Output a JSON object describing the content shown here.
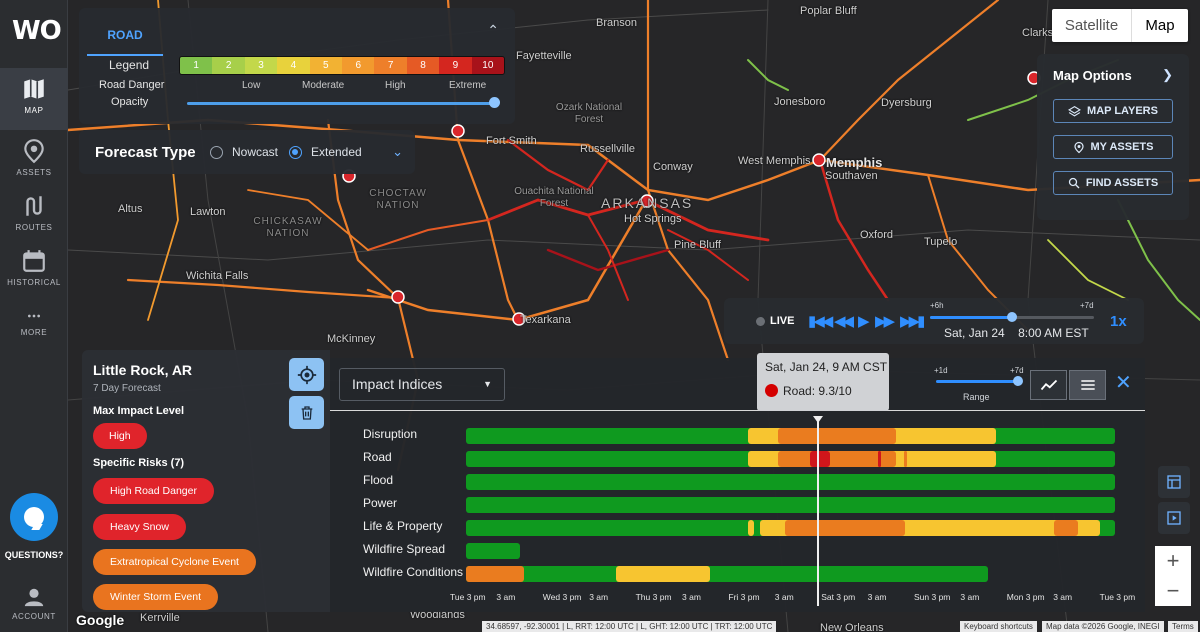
{
  "app": {
    "logo_text": "WO",
    "brand_color": "#1a8be3"
  },
  "nav": {
    "items": [
      {
        "label": "MAP",
        "icon": "map-icon"
      },
      {
        "label": "ASSETS",
        "icon": "location-pin-icon"
      },
      {
        "label": "ROUTES",
        "icon": "route-icon"
      },
      {
        "label": "HISTORICAL",
        "icon": "calendar-icon"
      },
      {
        "label": "MORE",
        "icon": "more-dots-icon"
      }
    ],
    "questions_label": "QUESTIONS?",
    "account_label": "ACCOUNT"
  },
  "legend": {
    "tab_label": "ROAD",
    "legend_label": "Legend",
    "road_danger_label": "Road Danger",
    "opacity_label": "Opacity",
    "opacity_value": 0.97,
    "scale": [
      {
        "v": "1",
        "c": "#7fc14a"
      },
      {
        "v": "2",
        "c": "#a7cf4a"
      },
      {
        "v": "3",
        "c": "#c3d84a"
      },
      {
        "v": "4",
        "c": "#e8d23c"
      },
      {
        "v": "5",
        "c": "#f2b233"
      },
      {
        "v": "6",
        "c": "#f29a2e"
      },
      {
        "v": "7",
        "c": "#ee7f2a"
      },
      {
        "v": "8",
        "c": "#e55a25"
      },
      {
        "v": "9",
        "c": "#d4261f"
      },
      {
        "v": "10",
        "c": "#a8121a"
      }
    ],
    "levels": [
      "Low",
      "Moderate",
      "High",
      "Extreme"
    ]
  },
  "forecast_type": {
    "title": "Forecast Type",
    "options": [
      "Nowcast",
      "Extended"
    ],
    "selected": "Extended"
  },
  "map_type": {
    "satellite_label": "Satellite",
    "map_label": "Map",
    "selected": "Map"
  },
  "map_options": {
    "title": "Map Options",
    "buttons": [
      "MAP LAYERS",
      "MY ASSETS",
      "FIND ASSETS"
    ]
  },
  "map": {
    "cities": [
      "Branson",
      "Poplar Bluff",
      "Fayetteville",
      "Jonesboro",
      "Dyersburg",
      "Fort Smith",
      "Russellville",
      "Conway",
      "West Memphis",
      "Memphis",
      "Southaven",
      "Altus",
      "Lawton",
      "Hot Springs",
      "Pine Bluff",
      "Oxford",
      "Tupelo",
      "Wichita Falls",
      "Texarkana",
      "McKinney",
      "Woodlands",
      "Kerrville",
      "New Orleans",
      "Clarks"
    ],
    "regions": [
      "CHOCTAW NATION",
      "CHICKASAW NATION",
      "Ozark National Forest",
      "Ouachita National Forest",
      "ARKANSAS"
    ]
  },
  "playback": {
    "live_label": "LIVE",
    "date": "Sat, Jan 24",
    "time": "8:00 AM EST",
    "tick_start": "+6h",
    "tick_end": "+7d",
    "speed": "1x",
    "progress": 0.5
  },
  "location": {
    "name": "Little Rock, AR",
    "subtitle": "7 Day Forecast",
    "max_impact_label": "Max Impact Level",
    "max_impact_value": "High",
    "specific_risks_label": "Specific Risks (7)",
    "risks": [
      {
        "label": "High Road Danger",
        "color": "red"
      },
      {
        "label": "Heavy Snow",
        "color": "red"
      },
      {
        "label": "Extratropical Cyclone Event",
        "color": "orange"
      },
      {
        "label": "Winter Storm Event",
        "color": "orange"
      }
    ]
  },
  "impact": {
    "selector_label": "Impact Indices",
    "range_label": "Range",
    "range_start": "+1d",
    "range_end": "+7d",
    "tooltip_time": "Sat, Jan 24, 9 AM CST",
    "tooltip_value": "Road: 9.3/10",
    "x_ticks": [
      "Tue 3 pm",
      "3 am",
      "Wed 3 pm",
      "3 am",
      "Thu 3 pm",
      "3 am",
      "Fri 3 pm",
      "3 am",
      "Sat 3 pm",
      "3 am",
      "Sun 3 pm",
      "3 am",
      "Mon 3 pm",
      "3 am",
      "Tue 3 pm"
    ],
    "rows": [
      "Disruption",
      "Road",
      "Flood",
      "Power",
      "Life & Property",
      "Wildfire Spread",
      "Wildfire Conditions"
    ]
  },
  "attribution": {
    "coords": "34.68597, -92.30001 | L, RRT: 12:00 UTC | L, GHT: 12:00 UTC | TRT: 12:00 UTC",
    "shortcuts": "Keyboard shortcuts",
    "mapdata": "Map data ©2026 Google, INEGI",
    "terms": "Terms",
    "google": "Google"
  }
}
